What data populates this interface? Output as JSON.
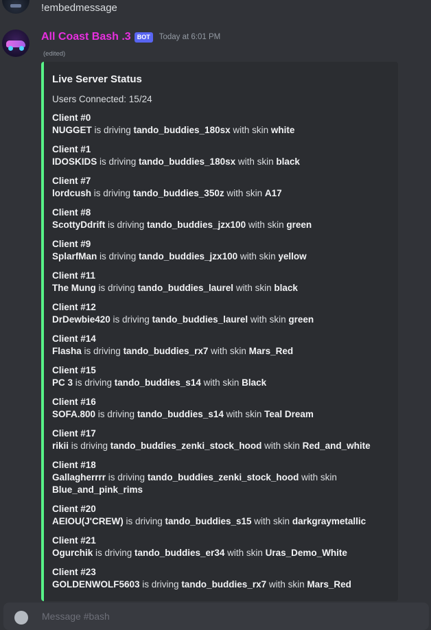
{
  "previous_message": {
    "text": "!embedmessage"
  },
  "message": {
    "author": "All Coast Bash .3",
    "bot_tag": "BOT",
    "timestamp": "Today at 6:01 PM",
    "edited": "(edited)"
  },
  "embed": {
    "accent_color": "#57f287",
    "title": "Live Server Status",
    "users_connected": "Users Connected: 15/24",
    "connector_driving": " is driving ",
    "connector_skin": " with skin ",
    "clients": [
      {
        "label": "Client #0",
        "player": "NUGGET",
        "car": "tando_buddies_180sx",
        "skin": "white"
      },
      {
        "label": "Client #1",
        "player": "IDOSKIDS",
        "car": "tando_buddies_180sx",
        "skin": "black"
      },
      {
        "label": "Client #7",
        "player": "lordcush",
        "car": "tando_buddies_350z",
        "skin": "A17"
      },
      {
        "label": "Client #8",
        "player": "ScottyDdrift",
        "car": "tando_buddies_jzx100",
        "skin": "green"
      },
      {
        "label": "Client #9",
        "player": "SplarfMan",
        "car": "tando_buddies_jzx100",
        "skin": "yellow"
      },
      {
        "label": "Client #11",
        "player": "The Mung",
        "car": "tando_buddies_laurel",
        "skin": "black"
      },
      {
        "label": "Client #12",
        "player": "DrDewbie420",
        "car": "tando_buddies_laurel",
        "skin": "green"
      },
      {
        "label": "Client #14",
        "player": "Flasha",
        "car": "tando_buddies_rx7",
        "skin": "Mars_Red"
      },
      {
        "label": "Client #15",
        "player": "PC 3",
        "car": "tando_buddies_s14",
        "skin": "Black"
      },
      {
        "label": "Client #16",
        "player": "SOFA.800",
        "car": "tando_buddies_s14",
        "skin": "Teal Dream"
      },
      {
        "label": "Client #17",
        "player": "rikii",
        "car": "tando_buddies_zenki_stock_hood",
        "skin": "Red_and_white"
      },
      {
        "label": "Client #18",
        "player": "Gallagherrrr",
        "car": "tando_buddies_zenki_stock_hood",
        "skin": "Blue_and_pink_rims"
      },
      {
        "label": "Client #20",
        "player": "AEIOU(J'CREW)",
        "car": "tando_buddies_s15",
        "skin": "darkgraymetallic"
      },
      {
        "label": "Client #21",
        "player": "Ogurchik",
        "car": "tando_buddies_er34",
        "skin": "Uras_Demo_White"
      },
      {
        "label": "Client #23",
        "player": "GOLDENWOLF5603",
        "car": "tando_buddies_rx7",
        "skin": "Mars_Red"
      }
    ]
  },
  "composer": {
    "placeholder": "Message #bash"
  }
}
